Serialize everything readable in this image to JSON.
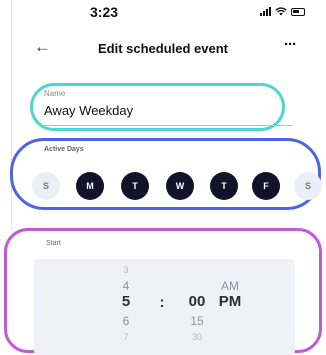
{
  "status": {
    "time": "3:23"
  },
  "header": {
    "title": "Edit scheduled event",
    "back_glyph": "←",
    "more_glyph": "···"
  },
  "name": {
    "label": "Name",
    "value": "Away Weekday"
  },
  "active_days": {
    "label": "Active Days",
    "days": [
      {
        "letter": "S",
        "active": false
      },
      {
        "letter": "M",
        "active": true
      },
      {
        "letter": "T",
        "active": true
      },
      {
        "letter": "W",
        "active": true
      },
      {
        "letter": "T",
        "active": true
      },
      {
        "letter": "F",
        "active": true
      },
      {
        "letter": "S",
        "active": false
      }
    ]
  },
  "start": {
    "label": "Start",
    "hours": [
      "3",
      "4",
      "5",
      "6",
      "7"
    ],
    "separator": ":",
    "minutes": [
      "00",
      "15",
      "30"
    ],
    "periods": [
      "AM",
      "PM"
    ]
  },
  "colors": {
    "name_highlight": "#4dd6d2",
    "days_highlight": "#4c63e6",
    "start_highlight": "#c25ad8",
    "day_active": "#12122a",
    "day_inactive": "#eceef6"
  }
}
